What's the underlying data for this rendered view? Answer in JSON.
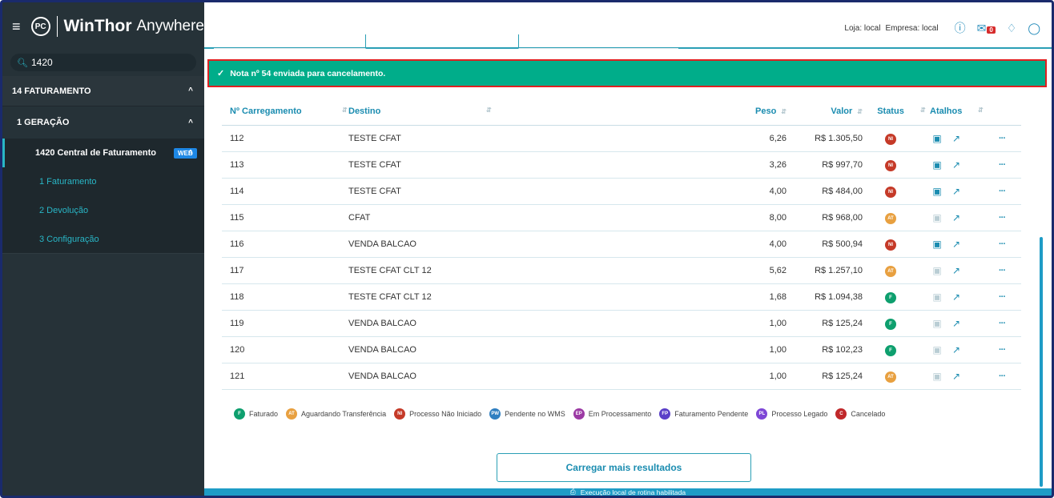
{
  "sidebar": {
    "brand_bold": "WinThor",
    "brand_light": "Anywhere",
    "logo_text": "PC",
    "search_value": "1420",
    "l1_label": "14  FATURAMENTO",
    "l2_label": "1  GERAÇÃO",
    "l3_label": "1420  Central de Faturamento",
    "l3_badge": "WEB",
    "sub_items": [
      "1  Faturamento",
      "2  Devolução",
      "3  Configuração"
    ]
  },
  "topbar": {
    "loja": "Loja: local",
    "empresa": "Empresa: local",
    "mail_count": "0"
  },
  "notification": {
    "message": "Nota nº 54 enviada para cancelamento."
  },
  "table": {
    "headers": [
      "Nº Carregamento",
      "Destino",
      "Peso",
      "Valor",
      "Status",
      "Atalhos"
    ],
    "rows": [
      {
        "carregamento": "112",
        "destino": "TESTE CFAT",
        "peso": "6,26",
        "valor": "R$ 1.305,50",
        "status": "NI",
        "shortcut_active": true
      },
      {
        "carregamento": "113",
        "destino": "TESTE CFAT",
        "peso": "3,26",
        "valor": "R$ 997,70",
        "status": "NI",
        "shortcut_active": true
      },
      {
        "carregamento": "114",
        "destino": "TESTE CFAT",
        "peso": "4,00",
        "valor": "R$ 484,00",
        "status": "NI",
        "shortcut_active": true
      },
      {
        "carregamento": "115",
        "destino": "CFAT",
        "peso": "8,00",
        "valor": "R$ 968,00",
        "status": "AT",
        "shortcut_active": false
      },
      {
        "carregamento": "116",
        "destino": "VENDA BALCAO",
        "peso": "4,00",
        "valor": "R$ 500,94",
        "status": "NI",
        "shortcut_active": true
      },
      {
        "carregamento": "117",
        "destino": "TESTE CFAT CLT 12",
        "peso": "5,62",
        "valor": "R$ 1.257,10",
        "status": "AT",
        "shortcut_active": false
      },
      {
        "carregamento": "118",
        "destino": "TESTE CFAT CLT 12",
        "peso": "1,68",
        "valor": "R$ 1.094,38",
        "status": "F",
        "shortcut_active": false
      },
      {
        "carregamento": "119",
        "destino": "VENDA BALCAO",
        "peso": "1,00",
        "valor": "R$ 125,24",
        "status": "F",
        "shortcut_active": false
      },
      {
        "carregamento": "120",
        "destino": "VENDA BALCAO",
        "peso": "1,00",
        "valor": "R$ 102,23",
        "status": "F",
        "shortcut_active": false
      },
      {
        "carregamento": "121",
        "destino": "VENDA BALCAO",
        "peso": "1,00",
        "valor": "R$ 125,24",
        "status": "AT",
        "shortcut_active": false
      }
    ]
  },
  "legend": [
    {
      "code": "F",
      "label": "Faturado",
      "color": "#0e9f6e"
    },
    {
      "code": "AT",
      "label": "Aguardando Transferência",
      "color": "#e8a040"
    },
    {
      "code": "NI",
      "label": "Processo Não Iniciado",
      "color": "#c53a28"
    },
    {
      "code": "PW",
      "label": "Pendente no WMS",
      "color": "#2f7fc1"
    },
    {
      "code": "EP",
      "label": "Em Processamento",
      "color": "#9c3aa4"
    },
    {
      "code": "FP",
      "label": "Faturamento Pendente",
      "color": "#5a3fc8"
    },
    {
      "code": "PL",
      "label": "Processo Legado",
      "color": "#7e47d6"
    },
    {
      "code": "C",
      "label": "Cancelado",
      "color": "#c0282a"
    }
  ],
  "load_more_label": "Carregar mais resultados",
  "footer_text": "Execução local de rotina habilitada",
  "colors": {
    "accent": "#1a8cb0",
    "sidebar_bg": "#263238",
    "notification_bg": "#00ad8a",
    "notification_border": "#e02020"
  }
}
